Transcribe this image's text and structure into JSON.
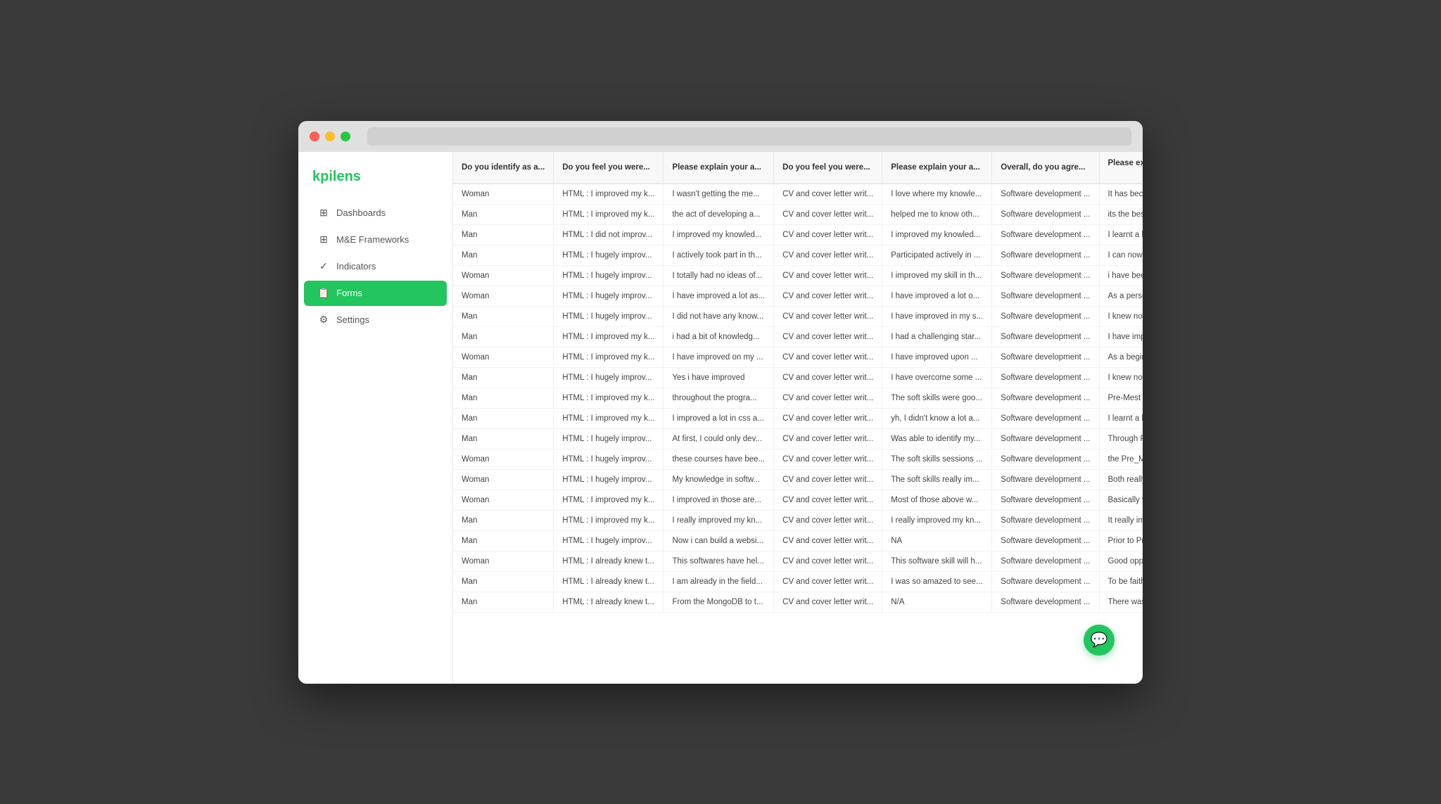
{
  "app": {
    "logo": "kpilens",
    "titlebar_dots": [
      "red",
      "yellow",
      "green"
    ]
  },
  "sidebar": {
    "items": [
      {
        "id": "dashboards",
        "label": "Dashboards",
        "icon": "grid",
        "active": false
      },
      {
        "id": "me-frameworks",
        "label": "M&E Frameworks",
        "icon": "grid",
        "active": false
      },
      {
        "id": "indicators",
        "label": "Indicators",
        "icon": "check-list",
        "active": false
      },
      {
        "id": "forms",
        "label": "Forms",
        "icon": "form",
        "active": true
      },
      {
        "id": "settings",
        "label": "Settings",
        "icon": "gear",
        "active": false
      }
    ]
  },
  "table": {
    "columns": [
      "Do you identify as a...",
      "Do you feel you were...",
      "Please explain your a...",
      "Do you feel you were...",
      "Please explain your a...",
      "Overall, do you agre...",
      "Please explain your a..."
    ],
    "rows": [
      [
        "Woman",
        "HTML : I improved my k...",
        "I wasn't getting the me...",
        "CV and cover letter writ...",
        "I love where my knowle...",
        "Software development ...",
        "It has because they gav..."
      ],
      [
        "Man",
        "HTML : I improved my k...",
        "the act of developing a...",
        "CV and cover letter writ...",
        "helped me to know oth...",
        "Software development ...",
        "its the best training any..."
      ],
      [
        "Man",
        "HTML : I did not improv...",
        "I improved my knowled...",
        "CV and cover letter writ...",
        "I improved my knowled...",
        "Software development ...",
        "I learnt a lot in the Pre-..."
      ],
      [
        "Man",
        "HTML : I hugely improv...",
        "I actively took part in th...",
        "CV and cover letter writ...",
        "Participated actively in ...",
        "Software development ...",
        "I can now develop a we..."
      ],
      [
        "Woman",
        "HTML : I hugely improv...",
        "I totally had no ideas of...",
        "CV and cover letter writ...",
        "I improved my skill in th...",
        "Software development ...",
        "i have been adequately ..."
      ],
      [
        "Woman",
        "HTML : I hugely improv...",
        "I have improved a lot as...",
        "CV and cover letter writ...",
        "I have improved a lot o...",
        "Software development ...",
        "As a person with zero k..."
      ],
      [
        "Man",
        "HTML : I hugely improv...",
        "I did not have any know...",
        "CV and cover letter writ...",
        "I have improved in my s...",
        "Software development ...",
        "I knew nothing about a..."
      ],
      [
        "Man",
        "HTML : I improved my k...",
        "i had a bit of knowledg...",
        "CV and cover letter writ...",
        "I had a challenging star...",
        "Software development ...",
        "I have improved my skil..."
      ],
      [
        "Woman",
        "HTML : I improved my k...",
        "I have improved on my ...",
        "CV and cover letter writ...",
        "I have improved upon ...",
        "Software development ...",
        "As a beginner, I never t..."
      ],
      [
        "Man",
        "HTML : I hugely improv...",
        "Yes i have improved",
        "CV and cover letter writ...",
        "I have overcome some ...",
        "Software development ...",
        "I knew noting about sof..."
      ],
      [
        "Man",
        "HTML : I improved my k...",
        "throughout the progra...",
        "CV and cover letter writ...",
        "The soft skills were goo...",
        "Software development ...",
        "Pre-Mest really contrib..."
      ],
      [
        "Man",
        "HTML : I improved my k...",
        "I improved a lot in css a...",
        "CV and cover letter writ...",
        "yh, I didn't know a lot a...",
        "Software development ...",
        "I learnt a lot from both t..."
      ],
      [
        "Man",
        "HTML : I hugely improv...",
        "At first, I could only dev...",
        "CV and cover letter writ...",
        "Was able to identify my...",
        "Software development ...",
        "Through Pre-Mest I go ..."
      ],
      [
        "Woman",
        "HTML : I hugely improv...",
        "these courses have bee...",
        "CV and cover letter writ...",
        "The soft skills sessions ...",
        "Software development ...",
        "the Pre_MEST program..."
      ],
      [
        "Woman",
        "HTML : I hugely improv...",
        "My knowledge in softw...",
        "CV and cover letter writ...",
        "The soft skills really im...",
        "Software development ...",
        "Both really helped me t..."
      ],
      [
        "Woman",
        "HTML : I improved my k...",
        "I improved in those are...",
        "CV and cover letter writ...",
        "Most of those above w...",
        "Software development ...",
        "Basically we've had the..."
      ],
      [
        "Man",
        "HTML : I improved my k...",
        "I really improved my kn...",
        "CV and cover letter writ...",
        "I really improved my kn...",
        "Software development ...",
        "It really improved my k..."
      ],
      [
        "Man",
        "HTML : I hugely improv...",
        "Now i can build a websi...",
        "CV and cover letter writ...",
        "NA",
        "Software development ...",
        "Prior to Pre-Mest i did ..."
      ],
      [
        "Woman",
        "HTML : I already knew t...",
        "This softwares have hel...",
        "CV and cover letter writ...",
        "This software skill will h...",
        "Software development ...",
        "Good opportunity"
      ],
      [
        "Man",
        "HTML : I already knew t...",
        "I am already in the field...",
        "CV and cover letter writ...",
        "I was so amazed to see...",
        "Software development ...",
        "To be faithful, this has ..."
      ],
      [
        "Man",
        "HTML : I already knew t...",
        "From the MongoDB to t...",
        "CV and cover letter writ...",
        "N/A",
        "Software development ...",
        "There was no way I cou..."
      ]
    ]
  },
  "chat_button": "💬"
}
